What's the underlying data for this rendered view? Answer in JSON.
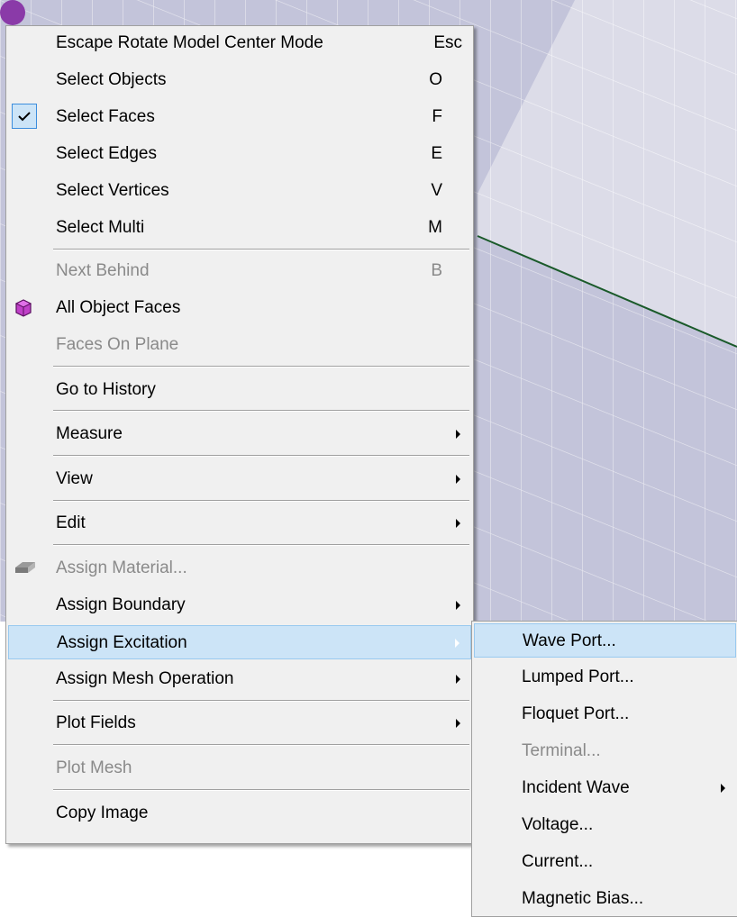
{
  "main_menu": {
    "items": [
      {
        "label": "Escape Rotate Model Center Mode",
        "shortcut": "Esc"
      },
      {
        "label": "Select Objects",
        "shortcut": "O"
      },
      {
        "label": "Select Faces",
        "shortcut": "F",
        "checked": true
      },
      {
        "label": "Select Edges",
        "shortcut": "E"
      },
      {
        "label": "Select Vertices",
        "shortcut": "V"
      },
      {
        "label": "Select Multi",
        "shortcut": "M"
      },
      {
        "label": "Next Behind",
        "shortcut": "B",
        "disabled": true
      },
      {
        "label": "All Object Faces",
        "icon": "object-faces-icon"
      },
      {
        "label": "Faces On Plane",
        "disabled": true
      },
      {
        "label": "Go to History"
      },
      {
        "label": "Measure",
        "submenu": true
      },
      {
        "label": "View",
        "submenu": true
      },
      {
        "label": "Edit",
        "submenu": true
      },
      {
        "label": "Assign Material...",
        "disabled": true,
        "icon": "material-icon"
      },
      {
        "label": "Assign Boundary",
        "submenu": true
      },
      {
        "label": "Assign Excitation",
        "submenu": true,
        "highlighted": true
      },
      {
        "label": "Assign Mesh Operation",
        "submenu": true
      },
      {
        "label": "Plot Fields",
        "submenu": true
      },
      {
        "label": "Plot Mesh",
        "disabled": true
      },
      {
        "label": "Copy Image"
      }
    ]
  },
  "excitation_submenu": {
    "items": [
      {
        "label": "Wave Port...",
        "highlighted": true
      },
      {
        "label": "Lumped Port..."
      },
      {
        "label": "Floquet Port..."
      },
      {
        "label": "Terminal...",
        "disabled": true
      },
      {
        "label": "Incident Wave",
        "submenu": true
      },
      {
        "label": "Voltage..."
      },
      {
        "label": "Current..."
      },
      {
        "label": "Magnetic Bias..."
      }
    ]
  },
  "colors": {
    "menu_bg": "#f0f0f0",
    "highlight_bg": "#cce4f7",
    "highlight_border": "#99c9ef",
    "disabled_text": "#8a8a8a",
    "viewport_dark": "#c3c4da",
    "viewport_light": "#dcdce8",
    "edge_line": "#1a5a2a"
  }
}
